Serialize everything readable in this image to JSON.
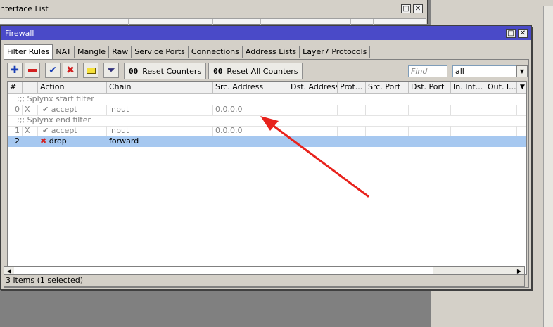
{
  "background_window": {
    "title": "nterface List"
  },
  "firewall": {
    "title": "Firewall",
    "tabs": [
      {
        "label": "Filter Rules"
      },
      {
        "label": "NAT"
      },
      {
        "label": "Mangle"
      },
      {
        "label": "Raw"
      },
      {
        "label": "Service Ports"
      },
      {
        "label": "Connections"
      },
      {
        "label": "Address Lists"
      },
      {
        "label": "Layer7 Protocols"
      }
    ],
    "toolbar": {
      "reset_counters_icon": "00",
      "reset_counters_label": "Reset Counters",
      "reset_all_icon": "00",
      "reset_all_label": "Reset All Counters",
      "find_placeholder": "Find",
      "filter_value": "all"
    },
    "columns": [
      "#",
      "",
      "Action",
      "Chain",
      "Src. Address",
      "Dst. Address",
      "Prot...",
      "Src. Port",
      "Dst. Port",
      "In. Int...",
      "Out. I..."
    ],
    "rows": [
      {
        "kind": "comment",
        "text": ";;; Splynx start filter"
      },
      {
        "kind": "rule",
        "num": "0",
        "flag": "X",
        "action": "accept",
        "chain": "input",
        "src": "0.0.0.0",
        "disabled": true
      },
      {
        "kind": "comment",
        "text": ";;; Splynx end filter"
      },
      {
        "kind": "rule",
        "num": "1",
        "flag": "X",
        "action": "accept",
        "chain": "input",
        "src": "0.0.0.0",
        "disabled": true
      },
      {
        "kind": "rule",
        "num": "2",
        "flag": "",
        "action": "drop",
        "chain": "forward",
        "src": "",
        "disabled": false,
        "selected": true
      }
    ],
    "status": "3 items (1 selected)"
  },
  "colors": {
    "titlebar": "#4a4ac8",
    "selected_row": "#a6c8f0",
    "annotation_arrow": "#e8221c"
  }
}
